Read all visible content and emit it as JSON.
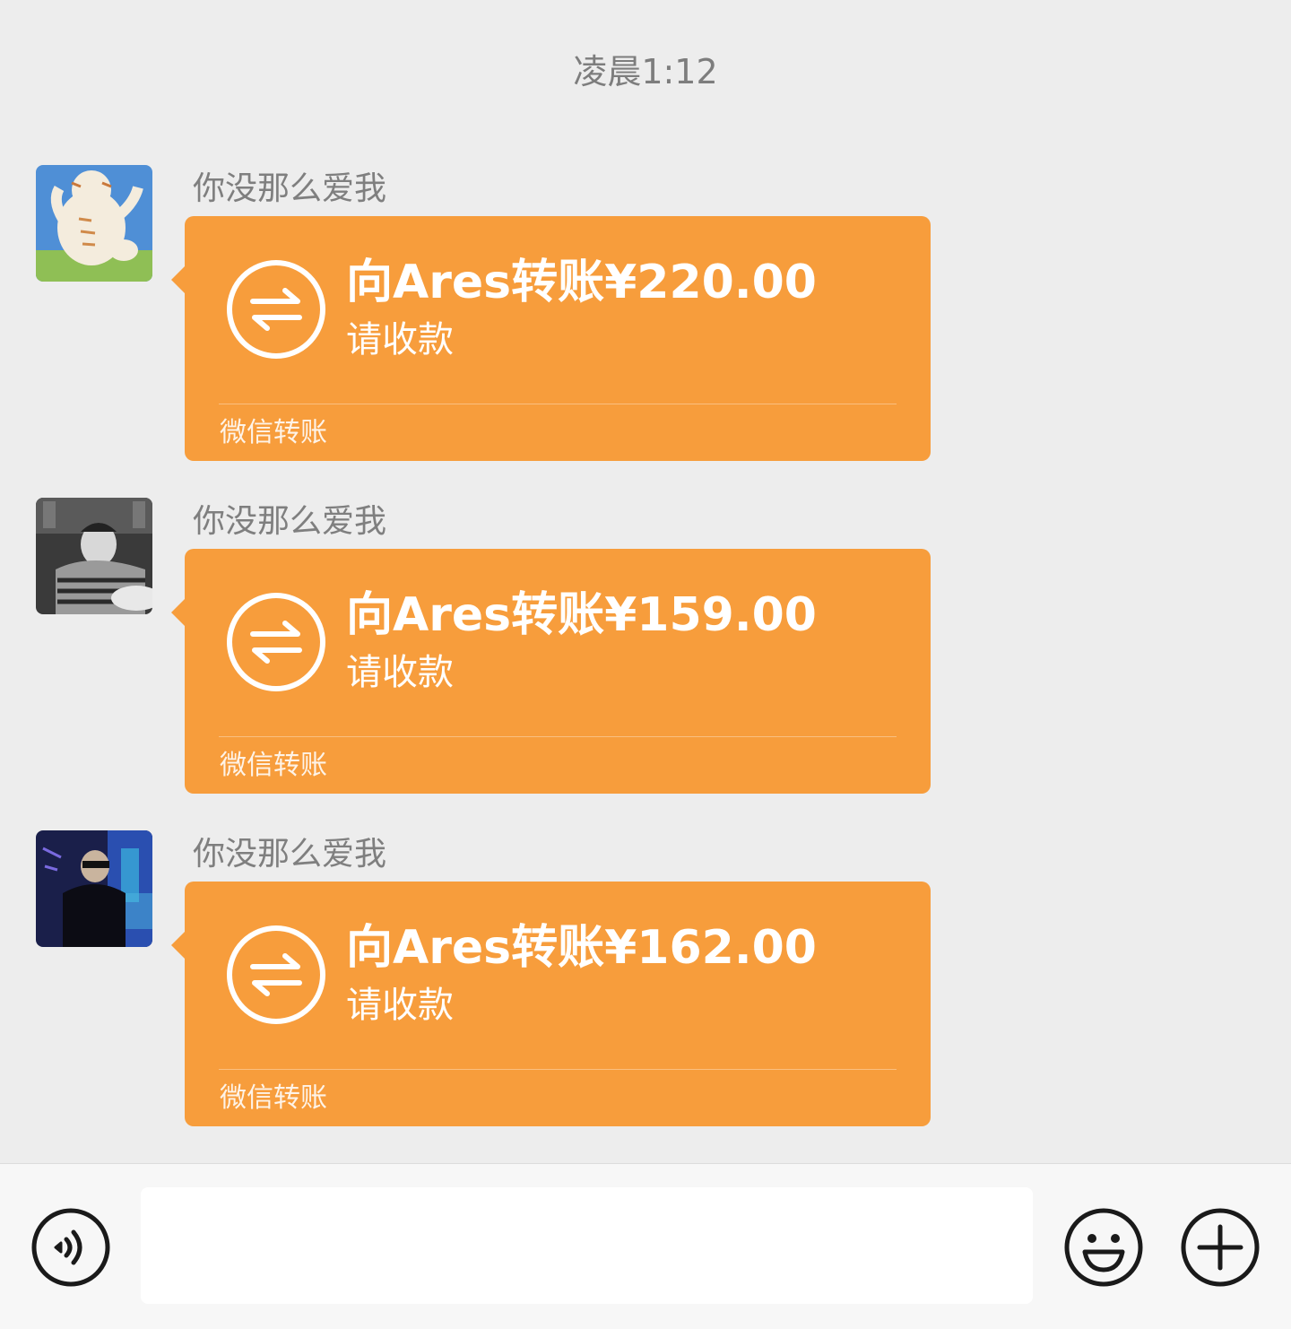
{
  "chat": {
    "timestamp": "凌晨1:12",
    "messages": [
      {
        "sender": "你没那么爱我",
        "avatar": "avatar-tiger-cartoon",
        "amount_text": "向Ares转账¥220.00",
        "status": "请收款",
        "footer": "微信转账"
      },
      {
        "sender": "你没那么爱我",
        "avatar": "avatar-photo-bw-man",
        "amount_text": "向Ares转账¥159.00",
        "status": "请收款",
        "footer": "微信转账"
      },
      {
        "sender": "你没那么爱我",
        "avatar": "avatar-photo-nightclub",
        "amount_text": "向Ares转账¥162.00",
        "status": "请收款",
        "footer": "微信转账"
      }
    ]
  },
  "input_bar": {
    "voice_icon": "voice-icon",
    "text_value": "",
    "emoji_icon": "emoji-icon",
    "plus_icon": "plus-icon"
  },
  "colors": {
    "background": "#ededed",
    "transfer_card": "#f79d3c",
    "text_muted": "#7f7f7f"
  }
}
